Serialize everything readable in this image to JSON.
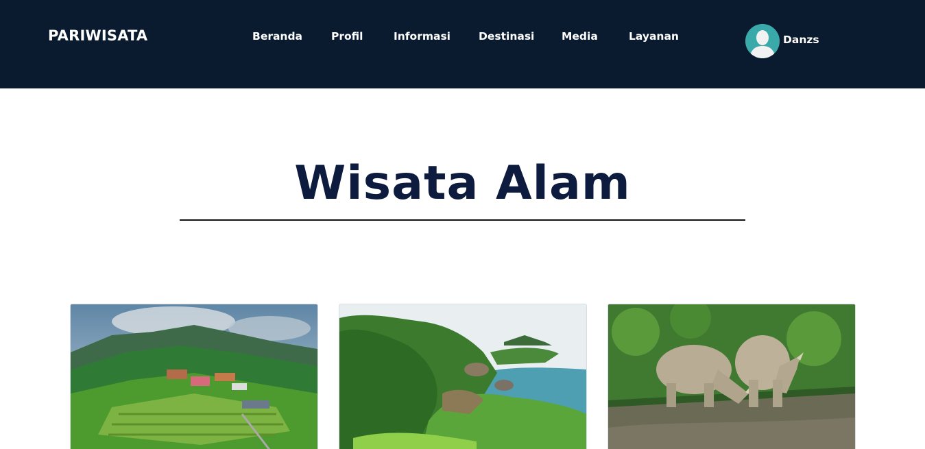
{
  "brand": "PARIWISATA",
  "nav": {
    "items": [
      "Beranda",
      "Profil",
      "Informasi",
      "Destinasi",
      "Media",
      "Layanan"
    ]
  },
  "user": {
    "name": "Danzs",
    "avatar_icon": "user-avatar-icon"
  },
  "section": {
    "title": "Wisata Alam"
  },
  "cards": [
    {
      "image": "hill-village-terraces-photo"
    },
    {
      "image": "green-coast-bay-photo"
    },
    {
      "image": "rhinoceros-pair-photo"
    }
  ],
  "colors": {
    "navbar": "#0a1a2f",
    "title": "#0d1b3e",
    "avatar_bg": "#3aa9a9"
  }
}
